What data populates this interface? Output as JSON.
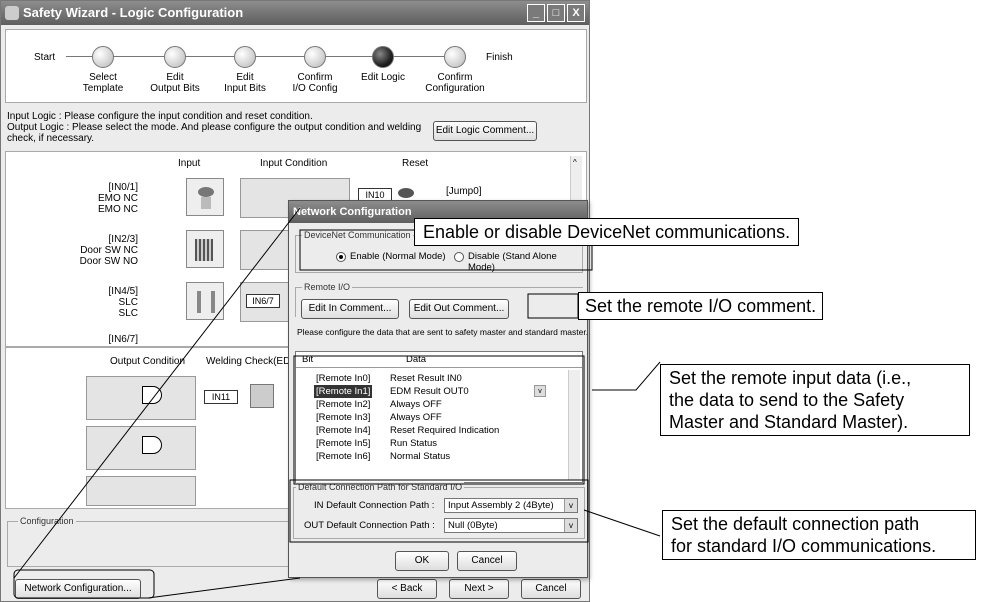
{
  "window": {
    "title": "Safety Wizard - Logic Configuration",
    "min": "_",
    "max": "□",
    "close": "X"
  },
  "wizard": {
    "start": "Start",
    "finish": "Finish",
    "steps": [
      {
        "l1": "Select",
        "l2": "Template"
      },
      {
        "l1": "Edit",
        "l2": "Output Bits"
      },
      {
        "l1": "Edit",
        "l2": "Input Bits"
      },
      {
        "l1": "Confirm",
        "l2": "I/O Config"
      },
      {
        "l1": "Edit Logic",
        "l2": ""
      },
      {
        "l1": "Confirm",
        "l2": "Configuration"
      }
    ]
  },
  "instructions": {
    "line1": "Input Logic : Please configure the input condition and reset condition.",
    "line2": "Output Logic : Please select the mode. And please configure the output condition and welding",
    "line3": "check, if necessary.",
    "edit_comment": "Edit Logic Comment..."
  },
  "logic": {
    "col_input": "Input",
    "col_input_condition": "Input Condition",
    "col_reset": "Reset",
    "inputs": [
      {
        "id": "[IN0/1]",
        "a": "EMO NC",
        "b": "EMO NC"
      },
      {
        "id": "[IN2/3]",
        "a": "Door SW NC",
        "b": "Door SW NO"
      },
      {
        "id": "[IN4/5]",
        "a": "SLC",
        "b": "SLC"
      },
      {
        "id": "[IN6/7]",
        "a": "",
        "b": ""
      }
    ],
    "in_tag": "IN6/7",
    "reset_tag": "IN10",
    "jump": "[Jump0]"
  },
  "output": {
    "col_output_condition": "Output Condition",
    "col_welding": "Welding Check(EDM)",
    "in_tag": "IN11"
  },
  "config_group": "Configuration",
  "buttons": {
    "network": "Network Configuration...",
    "back": "< Back",
    "next": "Next >",
    "cancel": "Cancel"
  },
  "dialog": {
    "title": "Network Configuration",
    "devicenet_group": "DeviceNet Communication",
    "enable": "Enable (Normal Mode)",
    "disable": "Disable (Stand Alone Mode)",
    "remote_group": "Remote I/O",
    "edit_in": "Edit In Comment...",
    "edit_out": "Edit Out Comment...",
    "configure_text": "Please configure the data that are sent to safety master and standard master.",
    "col_bit": "Bit",
    "col_data": "Data",
    "rows": [
      {
        "bit": "[Remote In0]",
        "data": "Reset Result IN0"
      },
      {
        "bit": "[Remote In1]",
        "data": "EDM Result OUT0"
      },
      {
        "bit": "[Remote In2]",
        "data": "Always OFF"
      },
      {
        "bit": "[Remote In3]",
        "data": "Always OFF"
      },
      {
        "bit": "[Remote In4]",
        "data": "Reset Required Indication"
      },
      {
        "bit": "[Remote In5]",
        "data": "Run Status"
      },
      {
        "bit": "[Remote In6]",
        "data": "Normal Status"
      }
    ],
    "default_group": "Default Connection Path for Standard I/O",
    "in_label": "IN Default Connection Path :",
    "in_value": "Input Assembly 2 (4Byte)",
    "out_label": "OUT Default Connection Path :",
    "out_value": "Null (0Byte)",
    "ok": "OK",
    "cancel": "Cancel"
  },
  "callouts": {
    "enable": "Enable or disable DeviceNet communications.",
    "remote_comment": "Set the remote I/O comment.",
    "remote_input": [
      "Set the remote input data (i.e.,",
      "the data to send to the Safety",
      "Master and Standard Master)."
    ],
    "default_path": [
      "Set the default connection path",
      "for standard I/O communications."
    ]
  },
  "colors": {
    "titlebar": "#6e6e6e",
    "selection": "#333333"
  }
}
